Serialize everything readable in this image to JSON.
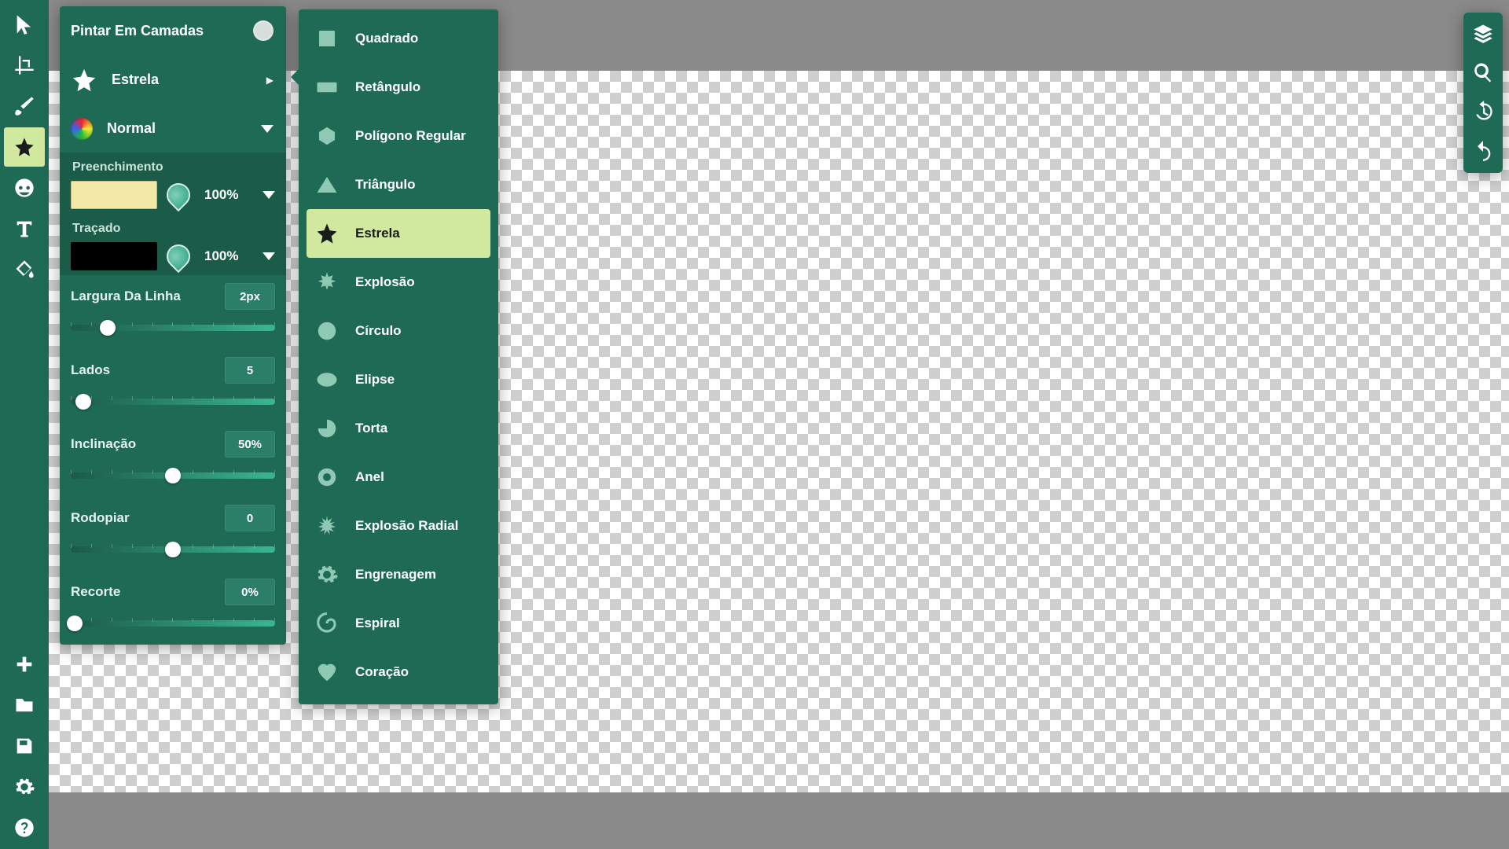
{
  "colors": {
    "panel": "#1e6a54",
    "accent": "#d1e89f",
    "fill_swatch": "#f2e8a8",
    "stroke_swatch": "#000000"
  },
  "left_toolbar": {
    "tools": [
      {
        "name": "pointer",
        "active": false
      },
      {
        "name": "crop",
        "active": false
      },
      {
        "name": "brush",
        "active": false
      },
      {
        "name": "shape",
        "active": true
      },
      {
        "name": "stamp",
        "active": false
      },
      {
        "name": "text",
        "active": false
      },
      {
        "name": "fill",
        "active": false
      }
    ],
    "bottom": [
      {
        "name": "add"
      },
      {
        "name": "folder"
      },
      {
        "name": "save"
      },
      {
        "name": "settings"
      },
      {
        "name": "help"
      }
    ]
  },
  "right_toolbar": {
    "items": [
      {
        "name": "layers"
      },
      {
        "name": "zoom"
      },
      {
        "name": "history"
      },
      {
        "name": "undo"
      }
    ]
  },
  "options": {
    "paint_in_layers_label": "Pintar Em Camadas",
    "paint_in_layers_on": false,
    "current_shape_label": "Estrela",
    "blend_mode_label": "Normal",
    "fill": {
      "title": "Preenchimento",
      "color": "#f2e8a8",
      "opacity": "100%"
    },
    "stroke": {
      "title": "Traçado",
      "color": "#000000",
      "opacity": "100%"
    },
    "sliders": [
      {
        "key": "line_width",
        "label": "Largura Da Linha",
        "value": "2px",
        "pos": 18
      },
      {
        "key": "sides",
        "label": "Lados",
        "value": "5",
        "pos": 6
      },
      {
        "key": "inset",
        "label": "Inclinação",
        "value": "50%",
        "pos": 50
      },
      {
        "key": "twirl",
        "label": "Rodopiar",
        "value": "0",
        "pos": 50
      },
      {
        "key": "cutout",
        "label": "Recorte",
        "value": "0%",
        "pos": 2
      }
    ]
  },
  "shape_menu": {
    "items": [
      {
        "key": "square",
        "label": "Quadrado"
      },
      {
        "key": "rectangle",
        "label": "Retângulo"
      },
      {
        "key": "regular_polygon",
        "label": "Polígono Regular"
      },
      {
        "key": "triangle",
        "label": "Triângulo"
      },
      {
        "key": "star",
        "label": "Estrela",
        "active": true
      },
      {
        "key": "burst",
        "label": "Explosão"
      },
      {
        "key": "circle",
        "label": "Círculo"
      },
      {
        "key": "ellipse",
        "label": "Elipse"
      },
      {
        "key": "pie",
        "label": "Torta"
      },
      {
        "key": "ring",
        "label": "Anel"
      },
      {
        "key": "radial_burst",
        "label": "Explosão Radial"
      },
      {
        "key": "gear",
        "label": "Engrenagem"
      },
      {
        "key": "spiral",
        "label": "Espiral"
      },
      {
        "key": "heart",
        "label": "Coração"
      }
    ]
  }
}
